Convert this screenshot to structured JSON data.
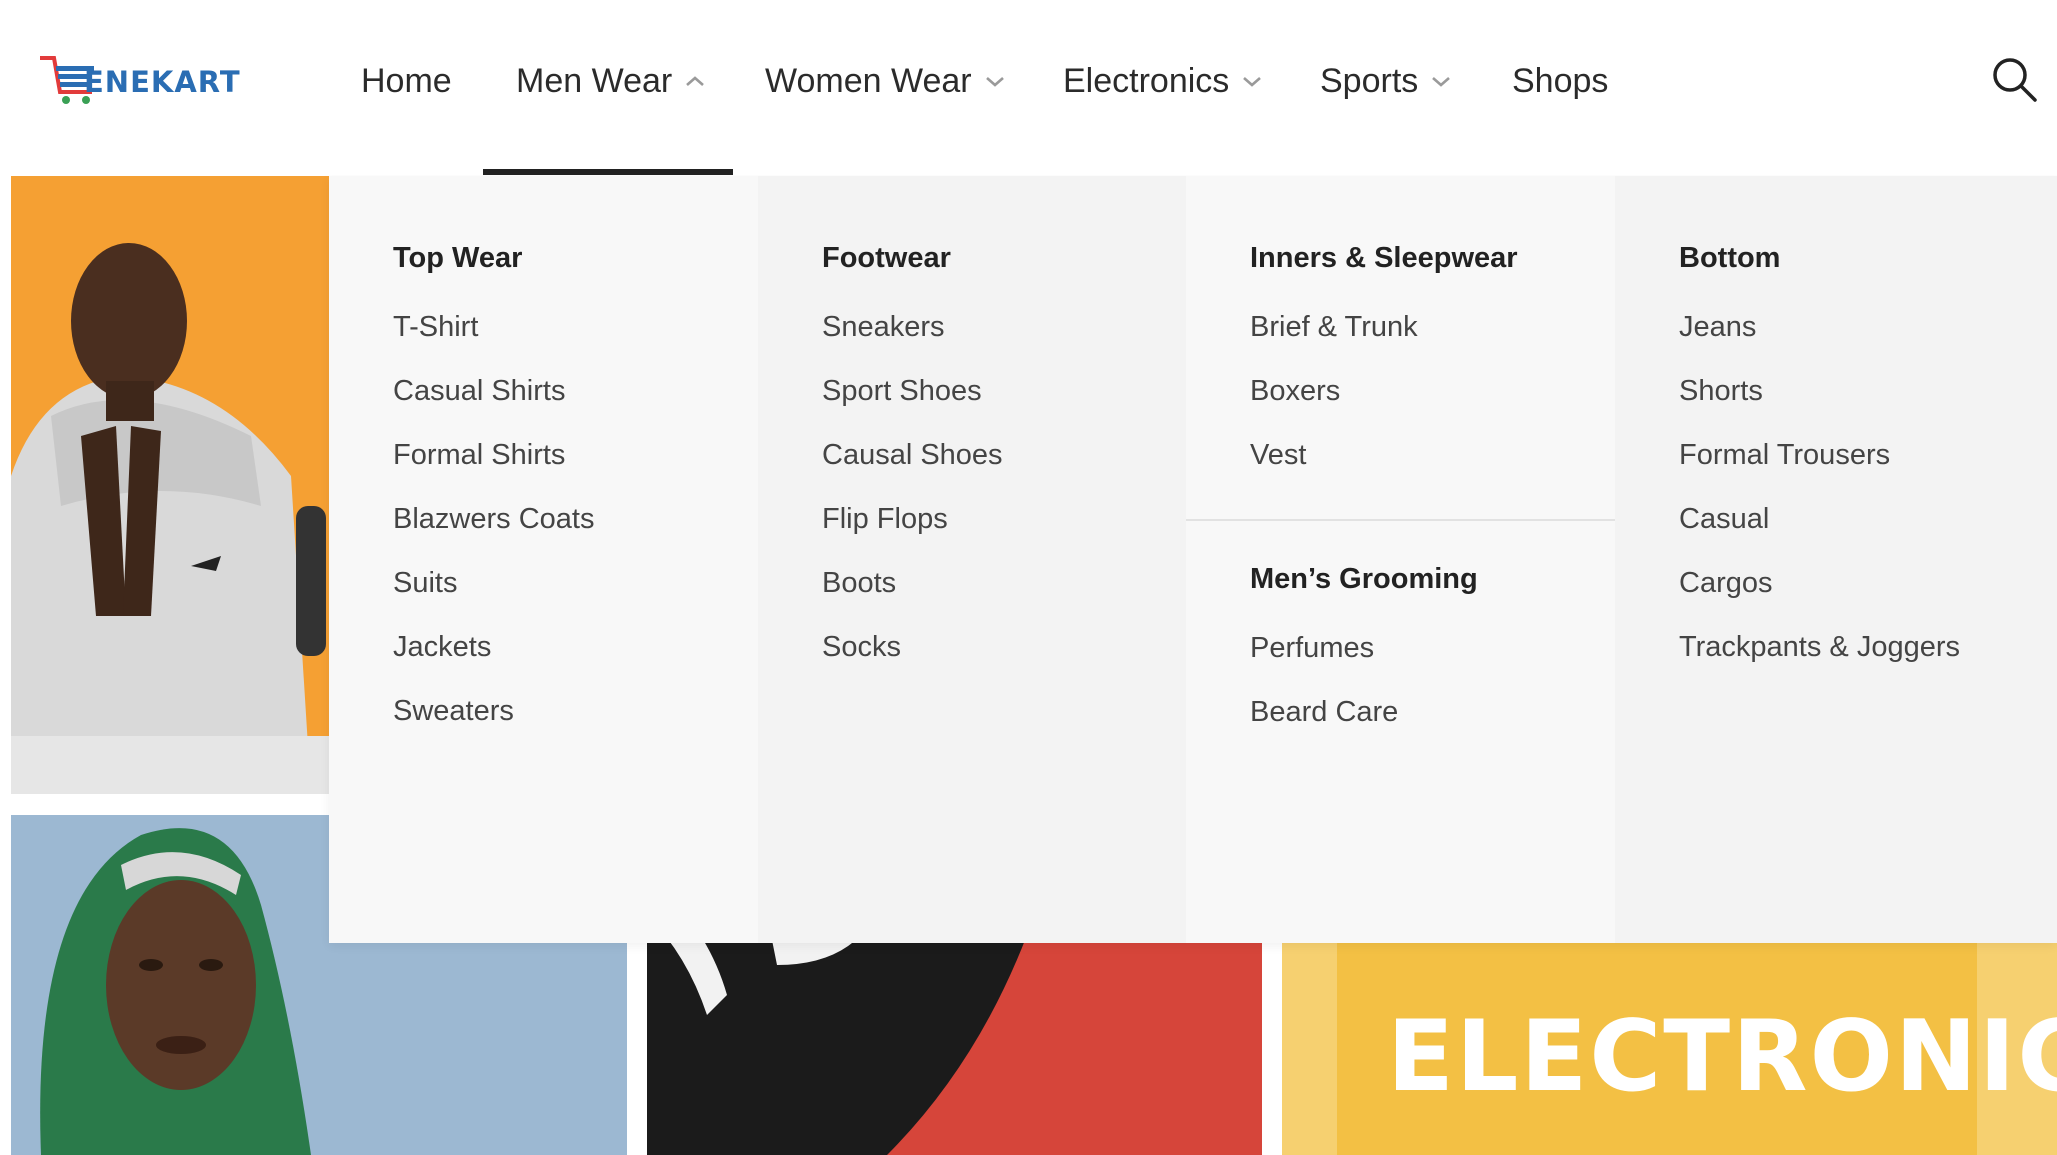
{
  "brand": {
    "name": "ENEKART",
    "colors": {
      "blue": "#2a6db3",
      "red": "#e23b3b",
      "green": "#3aa055"
    }
  },
  "nav": {
    "items": [
      {
        "label": "Home",
        "has_dropdown": false
      },
      {
        "label": "Men Wear",
        "has_dropdown": true,
        "expanded": true
      },
      {
        "label": "Women Wear",
        "has_dropdown": true,
        "expanded": false
      },
      {
        "label": "Electronics",
        "has_dropdown": true,
        "expanded": false
      },
      {
        "label": "Sports",
        "has_dropdown": true,
        "expanded": false
      },
      {
        "label": "Shops",
        "has_dropdown": false
      }
    ],
    "search_icon": "search-icon"
  },
  "mega_menu": {
    "columns": [
      {
        "groups": [
          {
            "title": "Top Wear",
            "links": [
              "T-Shirt",
              "Casual Shirts",
              "Formal Shirts",
              "Blazwers Coats",
              "Suits",
              "Jackets",
              "Sweaters"
            ]
          }
        ]
      },
      {
        "groups": [
          {
            "title": "Footwear",
            "links": [
              "Sneakers",
              "Sport Shoes",
              "Causal Shoes",
              "Flip Flops",
              "Boots",
              "Socks"
            ]
          }
        ]
      },
      {
        "groups": [
          {
            "title": "Inners & Sleepwear",
            "links": [
              "Brief & Trunk",
              "Boxers",
              "Vest"
            ]
          },
          {
            "title": "Men’s Grooming",
            "links": [
              "Perfumes",
              "Beard Care"
            ]
          }
        ]
      },
      {
        "groups": [
          {
            "title": "Bottom",
            "links": [
              "Jeans",
              "Shorts",
              "Formal Trousers",
              "Casual",
              "Cargos",
              "Trackpants & Joggers"
            ]
          }
        ]
      }
    ]
  },
  "hero": {
    "electronics_title": "ELECTRONICS",
    "tile_colors": {
      "man": "#f5a033",
      "woman": "#9cb8d2",
      "shoe": "#d6453a",
      "electronics": "#f6d070"
    }
  }
}
